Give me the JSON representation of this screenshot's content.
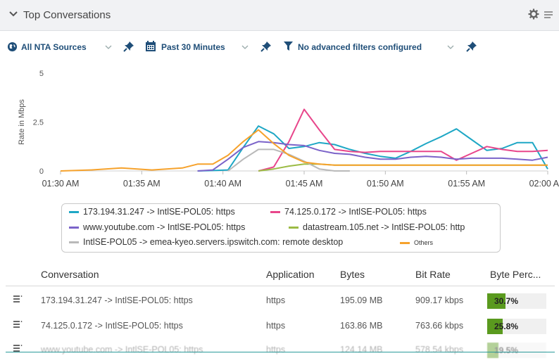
{
  "header": {
    "title": "Top Conversations"
  },
  "filters": {
    "source": "All NTA Sources",
    "time": "Past 30 Minutes",
    "advanced": "No advanced filters configured"
  },
  "chart_data": {
    "type": "line",
    "ylabel": "Rate in Mbps",
    "xlabel": "",
    "ylim": [
      0,
      5
    ],
    "yticks": [
      "0",
      "2.5",
      "5"
    ],
    "xtick_labels": [
      "01:30 AM",
      "01:35 AM",
      "01:40 AM",
      "01:45 AM",
      "01:50 AM",
      "01:55 AM",
      "02:00 AM"
    ],
    "xlim": [
      0,
      32
    ],
    "x": [
      0,
      2,
      4,
      6,
      8,
      9,
      10,
      11,
      12,
      13,
      14,
      15,
      16,
      17,
      18,
      19,
      20,
      21,
      22,
      23,
      24,
      25,
      26,
      27,
      28,
      29,
      30,
      31,
      32
    ],
    "series": [
      {
        "name": "173.194.31.247 -> IntlSE-POL05: https",
        "color": "#1ea7c5",
        "values": [
          null,
          null,
          null,
          null,
          null,
          0,
          0.02,
          0.05,
          1.2,
          2.3,
          1.9,
          1.15,
          1.25,
          1.45,
          1.35,
          1.1,
          0.9,
          0.75,
          0.65,
          1.0,
          1.4,
          1.75,
          2.15,
          1.6,
          1.05,
          1.15,
          1.45,
          1.45,
          0.1
        ]
      },
      {
        "name": "74.125.0.172 -> IntlSE-POL05: https",
        "color": "#e8468b",
        "values": [
          null,
          null,
          null,
          null,
          null,
          null,
          null,
          null,
          null,
          0,
          0.2,
          1.5,
          3.15,
          2.1,
          1.1,
          1.0,
          0.95,
          1.0,
          1.0,
          1.0,
          1.0,
          1.0,
          0.55,
          0.9,
          1.25,
          1.1,
          1.0,
          1.0,
          1.05
        ]
      },
      {
        "name": "www.youtube.com -> IntlSE-POL05: https",
        "color": "#7b63c9",
        "values": [
          null,
          null,
          null,
          null,
          null,
          0,
          0.05,
          0.6,
          1.2,
          1.5,
          1.45,
          1.35,
          1.3,
          1.05,
          0.9,
          0.85,
          0.7,
          0.6,
          0.6,
          0.7,
          0.75,
          0.7,
          0.6,
          0.65,
          0.65,
          0.65,
          0.6,
          0.55,
          0.7
        ]
      },
      {
        "name": "datastream.105.net -> IntlSE-POL05: http",
        "color": "#9cbb45",
        "values": [
          null,
          null,
          null,
          null,
          null,
          null,
          null,
          null,
          null,
          0,
          0.1,
          0.25,
          0.35,
          0.35,
          0.3,
          0.3,
          0.3,
          0.3,
          0.3,
          0.3,
          0.3,
          0.3,
          0.3,
          0.3,
          0.3,
          0.3,
          0.3,
          0.3,
          0.3
        ]
      },
      {
        "name": "IntlSE-POL05 -> emea-kyeo.servers.ipswitch.com: remote desktop",
        "color": "#b9b9b9",
        "values": [
          null,
          null,
          null,
          null,
          null,
          null,
          null,
          0,
          0.6,
          1.1,
          1.1,
          0.85,
          0.5,
          0.1,
          0,
          0,
          null,
          null,
          null,
          null,
          null,
          null,
          null,
          null,
          null,
          null,
          null,
          null,
          null
        ]
      },
      {
        "name": "Others",
        "color": "#f6a22c",
        "values": [
          0,
          0.05,
          0.15,
          0.05,
          0.15,
          0.35,
          0.35,
          0.8,
          1.5,
          2.1,
          1.4,
          0.8,
          0.45,
          0.35,
          0.3,
          0.3,
          0.3,
          0.3,
          0.3,
          0.3,
          0.3,
          0.3,
          0.3,
          0.3,
          0.3,
          0.3,
          0.3,
          0.3,
          0.3
        ]
      }
    ]
  },
  "table": {
    "columns": [
      "Conversation",
      "Application",
      "Bytes",
      "Bit Rate",
      "Byte Perc..."
    ],
    "rows": [
      {
        "conversation": "173.194.31.247 -> IntlSE-POL05: https",
        "application": "https",
        "bytes": "195.09 MB",
        "bit_rate": "909.17 kbps",
        "percent_label": "30.7%",
        "percent": 30.7
      },
      {
        "conversation": "74.125.0.172 -> IntlSE-POL05: https",
        "application": "https",
        "bytes": "163.86 MB",
        "bit_rate": "763.66 kbps",
        "percent_label": "25.8%",
        "percent": 25.8
      },
      {
        "conversation": "www.youtube.com -> IntlSE-POL05: https",
        "application": "https",
        "bytes": "124.14 MB",
        "bit_rate": "578.54 kbps",
        "percent_label": "19.5%",
        "percent": 19.5
      }
    ]
  }
}
